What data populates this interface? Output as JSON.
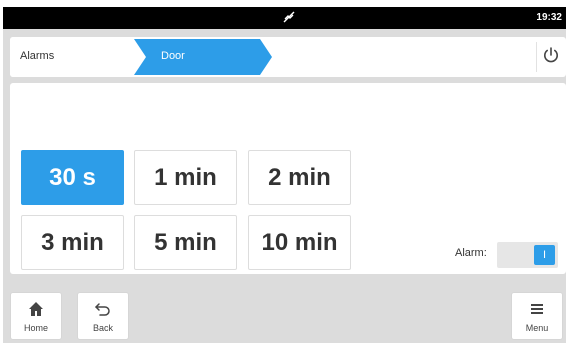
{
  "status_bar": {
    "icon": "no-signal-icon",
    "time": "19:32"
  },
  "breadcrumb": {
    "items": [
      {
        "label": "Alarms"
      },
      {
        "label": "Door"
      }
    ],
    "active_color": "#2d9de8"
  },
  "header_actions": {
    "power_icon": "power-icon"
  },
  "delay_options": {
    "selected": "30 s",
    "items": [
      {
        "label": "30 s"
      },
      {
        "label": "1 min"
      },
      {
        "label": "2 min"
      },
      {
        "label": "3 min"
      },
      {
        "label": "5 min"
      },
      {
        "label": "10 min"
      }
    ]
  },
  "alarm_toggle": {
    "label": "Alarm:",
    "state_text": "I",
    "on": true
  },
  "nav": {
    "home": {
      "label": "Home",
      "icon": "home-icon"
    },
    "back": {
      "label": "Back",
      "icon": "back-arrow-icon"
    },
    "menu": {
      "label": "Menu",
      "icon": "hamburger-menu-icon"
    }
  },
  "colors": {
    "accent": "#2d9de8",
    "background": "#dcdcdc",
    "status_bar": "#000000"
  }
}
